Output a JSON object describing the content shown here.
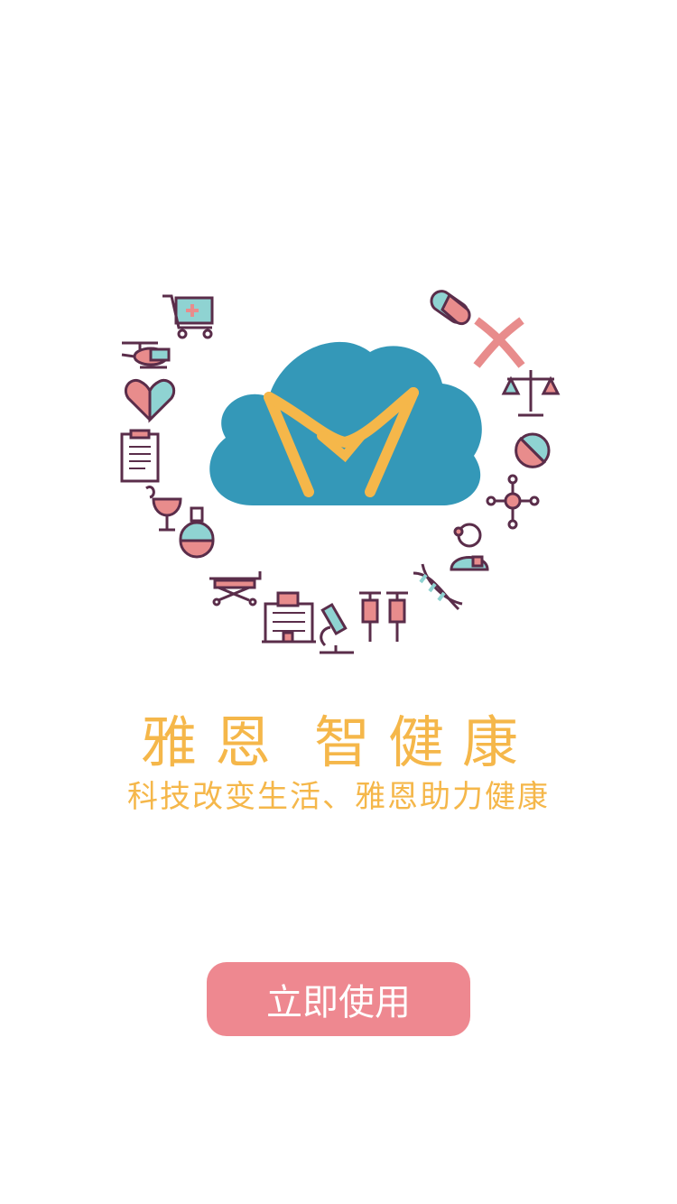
{
  "brand": {
    "name_part1": "雅恩",
    "name_part2": "智健康",
    "slogan": "科技改变生活、雅恩助力健康"
  },
  "actions": {
    "start_label": "立即使用"
  },
  "colors": {
    "accent": "#f5b74a",
    "cloud": "#3498b8",
    "button": "#ee8890",
    "icon_stroke": "#5a2d4a",
    "icon_pink": "#e88c8c",
    "icon_teal": "#8fd3d2"
  },
  "icons": [
    "shopping-cart-icon",
    "helicopter-icon",
    "heart-icon",
    "clipboard-icon",
    "hygeia-bowl-icon",
    "flask-icon",
    "stretcher-icon",
    "hospital-icon",
    "microscope-icon",
    "syringe-icon",
    "syringe-icon",
    "dna-icon",
    "doctor-icon",
    "molecule-icon",
    "pill-ball-icon",
    "scale-icon",
    "chromosome-icon",
    "capsule-icon"
  ]
}
